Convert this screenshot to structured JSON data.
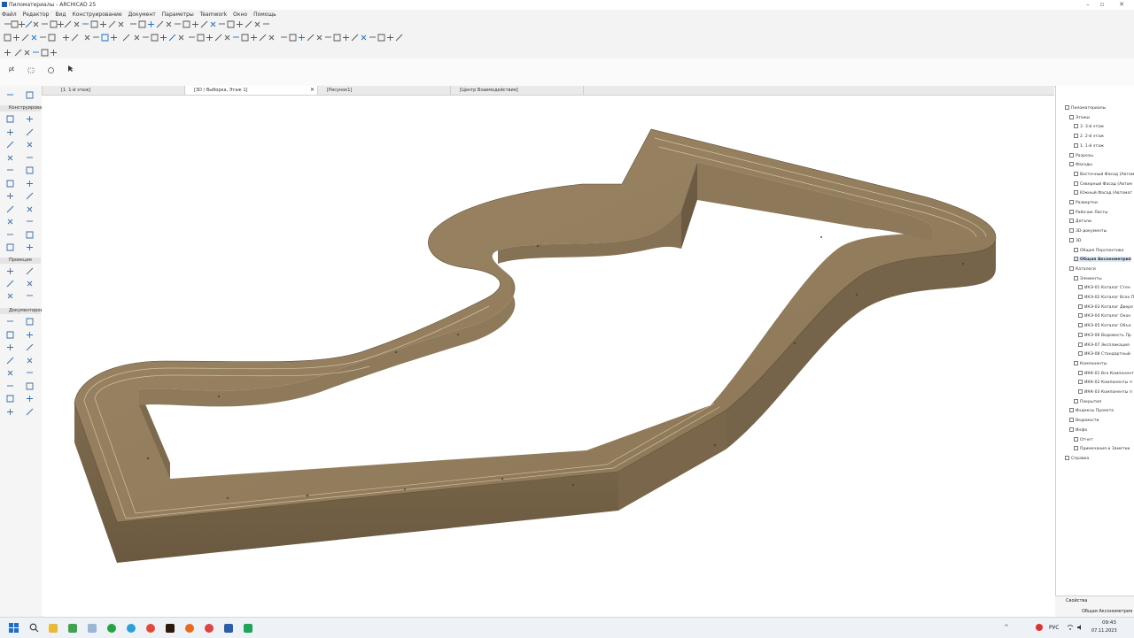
{
  "window": {
    "title": "Пиломатериалы - ARCHICAD 25"
  },
  "menu": [
    "Файл",
    "Редактор",
    "Вид",
    "Конструирование",
    "Документ",
    "Параметры",
    "Teamwork",
    "Окно",
    "Помощь"
  ],
  "toolbar": {
    "selection_label": "pt"
  },
  "tabs": [
    {
      "label": "[1. 1-й этаж]"
    },
    {
      "label": "[3D / Выборка, Этаж 1]"
    },
    {
      "label": "[Рисунок1]"
    },
    {
      "label": "[Центр Взаимодействия]"
    }
  ],
  "toolbox": {
    "sections": [
      {
        "label": "Конструирова"
      },
      {
        "label": "Проекция"
      },
      {
        "label": "Документиров"
      }
    ]
  },
  "navigator": {
    "items": [
      {
        "label": "Пиломатериалы"
      },
      {
        "label": "Этажи"
      },
      {
        "label": "3. 3-й этаж"
      },
      {
        "label": "2. 2-й этаж"
      },
      {
        "label": "1. 1-й этаж"
      },
      {
        "label": "Разрезы"
      },
      {
        "label": "Фасады"
      },
      {
        "label": "Восточный Фасад (Автом"
      },
      {
        "label": "Северный Фасад (Автом"
      },
      {
        "label": "Южный Фасад (Автомат"
      },
      {
        "label": "Развертки"
      },
      {
        "label": "Рабочие Листы"
      },
      {
        "label": "Детали"
      },
      {
        "label": "3D-документы"
      },
      {
        "label": "3D"
      },
      {
        "label": "Общая Перспектива"
      },
      {
        "label": "Общая Аксонометрия"
      },
      {
        "label": "Каталоги"
      },
      {
        "label": "Элементы"
      },
      {
        "label": "ИКЭ-01 Каталог Стен"
      },
      {
        "label": "ИКЭ-02 Каталог Всех П"
      },
      {
        "label": "ИКЭ-03 Каталог Двере"
      },
      {
        "label": "ИКЭ-04 Каталог Окон"
      },
      {
        "label": "ИКЭ-05 Каталог Объе"
      },
      {
        "label": "ИКЭ-06 Ведомость Пр"
      },
      {
        "label": "ИКЭ-07 Экспликация"
      },
      {
        "label": "ИКЭ-08 Стандартный"
      },
      {
        "label": "Компоненты"
      },
      {
        "label": "ИКК-01 Все Компонент"
      },
      {
        "label": "ИКК-02 Компоненты п"
      },
      {
        "label": "ИКК-03 Компоненты п"
      },
      {
        "label": "Покрытия"
      },
      {
        "label": "Индексы Проекта"
      },
      {
        "label": "Ведомости"
      },
      {
        "label": "Инфо"
      },
      {
        "label": "Отчет"
      },
      {
        "label": "Примечания и Заметки"
      },
      {
        "label": "Справка"
      }
    ]
  },
  "properties": {
    "header": "Свойства",
    "value": "Общая Аксонометрия"
  },
  "taskbar": {
    "lang": "РУС",
    "time": "09:43",
    "date": "07.11.2023"
  },
  "colors": {
    "accent": "#1e6ec8",
    "wood": "#8a7658",
    "wood_dark": "#6f5d44",
    "wood_light": "#a48f6e"
  }
}
